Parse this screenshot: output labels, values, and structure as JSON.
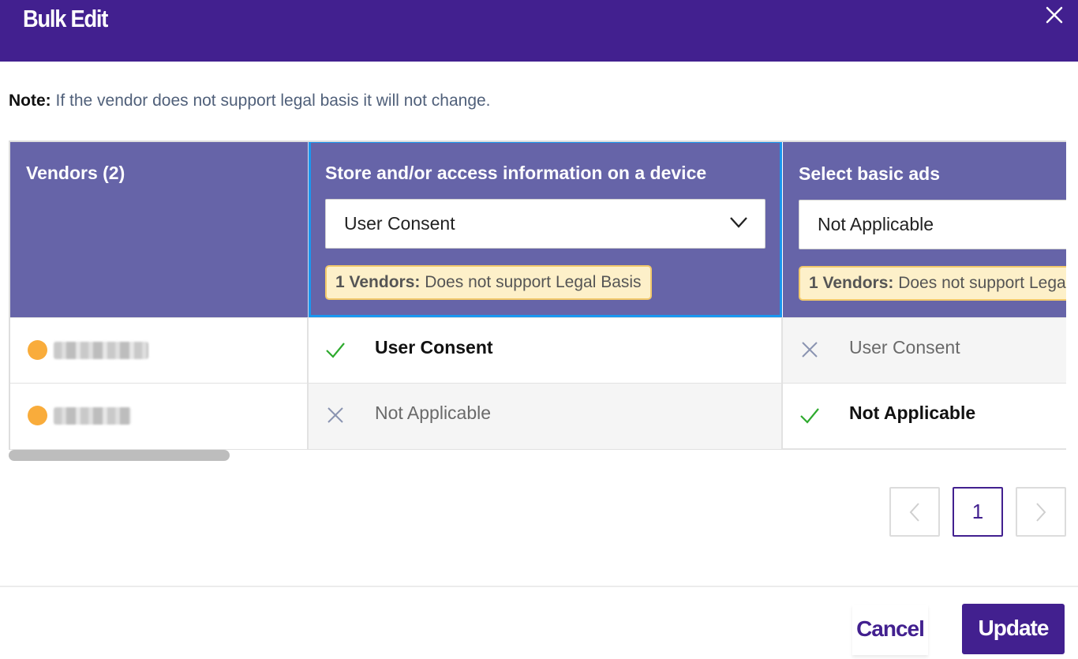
{
  "dialog": {
    "title": "Bulk Edit",
    "close_icon": "close-icon"
  },
  "note": {
    "label": "Note:",
    "text": " If the vendor does not support legal basis it will not change."
  },
  "table": {
    "vendors_header": "Vendors (2)",
    "purposes": [
      {
        "label": "Store and/or access information on a device",
        "selected": "User Consent",
        "warning_count": "1 Vendors:",
        "warning_text": " Does not support Legal Basis"
      },
      {
        "label": "Select basic ads",
        "selected": "Not Applicable",
        "warning_count": "1 Vendors:",
        "warning_text": " Does not support Legal Basis"
      }
    ],
    "rows": [
      {
        "status_color": "#f9ac3b",
        "cells": [
          {
            "icon": "check-icon",
            "text": "User Consent",
            "state": "on"
          },
          {
            "icon": "x-icon",
            "text": "User Consent",
            "state": "off"
          }
        ]
      },
      {
        "status_color": "#f9ac3b",
        "cells": [
          {
            "icon": "x-icon",
            "text": "Not Applicable",
            "state": "off"
          },
          {
            "icon": "check-icon",
            "text": "Not Applicable",
            "state": "on"
          }
        ]
      }
    ]
  },
  "pagination": {
    "prev_icon": "chevron-left-icon",
    "current_page": "1",
    "next_icon": "chevron-right-icon"
  },
  "footer": {
    "cancel_label": "Cancel",
    "update_label": "Update"
  },
  "colors": {
    "brand": "#42208f",
    "header_bg": "#6664a8",
    "focus": "#1a96ee",
    "check": "#2eaa2e",
    "warning_bg": "#fdf0c9",
    "vendor_dot": "#f9ac3b"
  }
}
